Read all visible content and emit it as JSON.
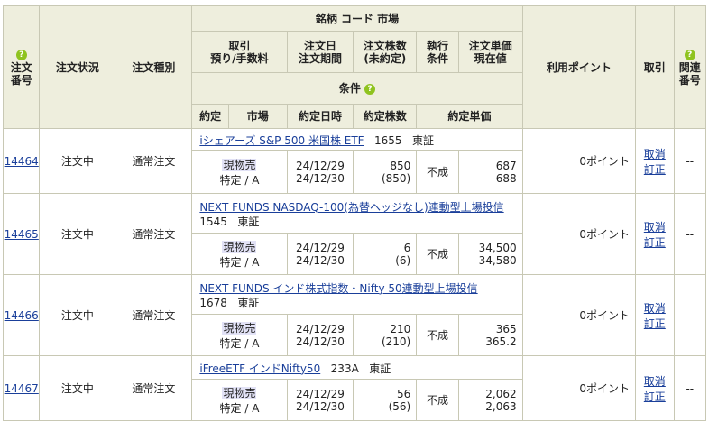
{
  "header": {
    "order_no": [
      "注文",
      "番号"
    ],
    "status": "注文状況",
    "type": "注文種別",
    "stock_code_market": "銘柄 コード 市場",
    "trade": [
      "取引",
      "預り/手数料"
    ],
    "order_date": [
      "注文日",
      "注文期間"
    ],
    "order_qty": [
      "注文株数",
      "(未約定)"
    ],
    "exec_cond": [
      "執行",
      "条件"
    ],
    "order_price": [
      "注文単価",
      "現在値"
    ],
    "condition": "条件",
    "contract": "約定",
    "market": "市場",
    "contract_dt": "約定日時",
    "contract_qty": "約定株数",
    "contract_price": "約定単価",
    "points": "利用ポイント",
    "torihiki": "取引",
    "related": [
      "関連",
      "番号"
    ],
    "help_icon": "question-circle-icon"
  },
  "orders": [
    {
      "no": "14464",
      "status": "注文中",
      "type": "通常注文",
      "name": "iシェアーズ S&P 500 米国株 ETF",
      "code": "1655",
      "market": "東証",
      "trade": "現物売",
      "account": "特定 / A",
      "date": "24/12/29",
      "period": "24/12/30",
      "qty": "850",
      "unfilled": "(850)",
      "cond": "不成",
      "price": "687",
      "current": "688",
      "points": "0ポイント",
      "cancel": "取消",
      "modify": "訂正",
      "related": "--"
    },
    {
      "no": "14465",
      "status": "注文中",
      "type": "通常注文",
      "name": "NEXT FUNDS NASDAQ-100(為替ヘッジなし)連動型上場投信",
      "code": "1545",
      "market": "東証",
      "trade": "現物売",
      "account": "特定 / A",
      "date": "24/12/29",
      "period": "24/12/30",
      "qty": "6",
      "unfilled": "(6)",
      "cond": "不成",
      "price": "34,500",
      "current": "34,580",
      "points": "0ポイント",
      "cancel": "取消",
      "modify": "訂正",
      "related": "--"
    },
    {
      "no": "14466",
      "status": "注文中",
      "type": "通常注文",
      "name": "NEXT FUNDS インド株式指数・Nifty 50連動型上場投信",
      "code": "1678",
      "market": "東証",
      "trade": "現物売",
      "account": "特定 / A",
      "date": "24/12/29",
      "period": "24/12/30",
      "qty": "210",
      "unfilled": "(210)",
      "cond": "不成",
      "price": "365",
      "current": "365.2",
      "points": "0ポイント",
      "cancel": "取消",
      "modify": "訂正",
      "related": "--"
    },
    {
      "no": "14467",
      "status": "注文中",
      "type": "通常注文",
      "name": "iFreeETF インドNifty50",
      "code": "233A",
      "market": "東証",
      "trade": "現物売",
      "account": "特定 / A",
      "date": "24/12/29",
      "period": "24/12/30",
      "qty": "56",
      "unfilled": "(56)",
      "cond": "不成",
      "price": "2,062",
      "current": "2,063",
      "points": "0ポイント",
      "cancel": "取消",
      "modify": "訂正",
      "related": "--"
    }
  ]
}
